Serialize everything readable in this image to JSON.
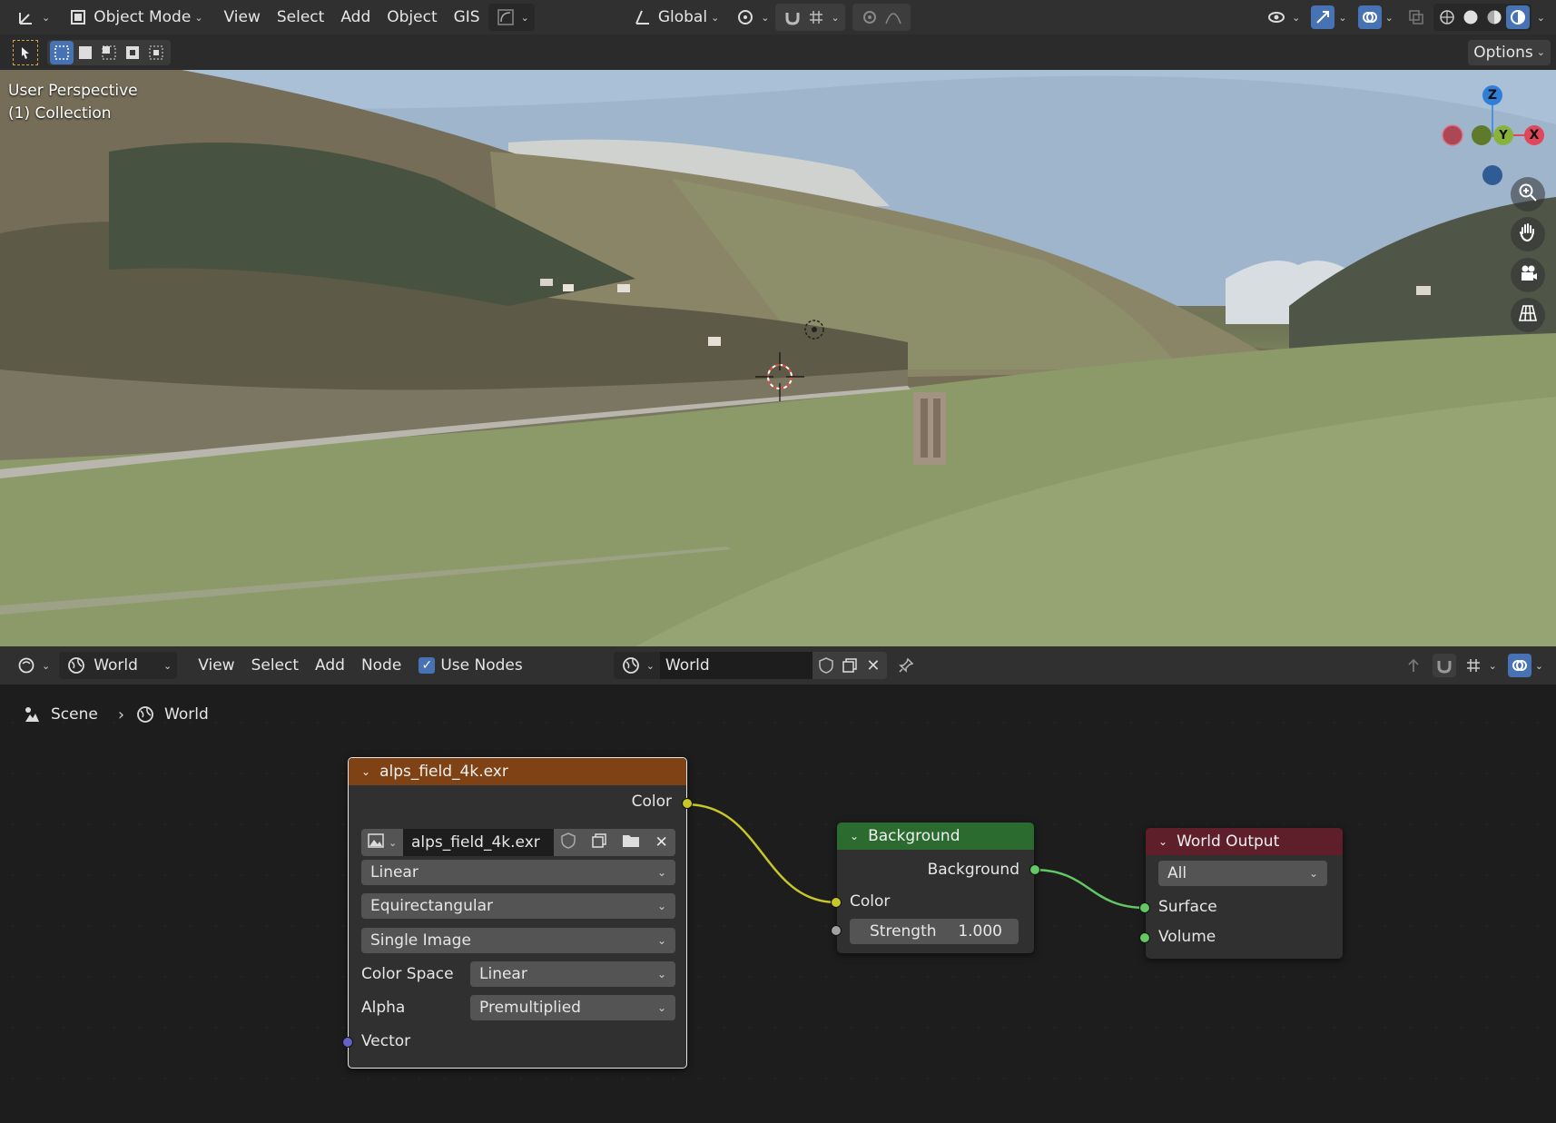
{
  "top_header": {
    "mode": "Object Mode",
    "menus": [
      "View",
      "Select",
      "Add",
      "Object",
      "GIS"
    ],
    "transform_orientation": "Global"
  },
  "tool_header": {
    "options_label": "Options"
  },
  "viewport": {
    "view_name": "User Perspective",
    "collection": "(1) Collection",
    "gizmo": {
      "z": "Z",
      "y": "Y",
      "x": "X"
    }
  },
  "node_header": {
    "editor_type": "World",
    "menus": [
      "View",
      "Select",
      "Add",
      "Node"
    ],
    "use_nodes_label": "Use Nodes",
    "use_nodes_checked": true,
    "world_name": "World"
  },
  "breadcrumb": {
    "scene": "Scene",
    "world": "World"
  },
  "nodes": {
    "image_texture": {
      "title": "alps_field_4k.exr",
      "output_color": "Color",
      "image_name": "alps_field_4k.exr",
      "interpolation": "Linear",
      "projection": "Equirectangular",
      "source": "Single Image",
      "color_space_label": "Color Space",
      "color_space_value": "Linear",
      "alpha_label": "Alpha",
      "alpha_value": "Premultiplied",
      "input_vector": "Vector"
    },
    "background": {
      "title": "Background",
      "output": "Background",
      "input_color": "Color",
      "strength_label": "Strength",
      "strength_value": "1.000"
    },
    "world_output": {
      "title": "World Output",
      "target": "All",
      "input_surface": "Surface",
      "input_volume": "Volume"
    }
  },
  "colors": {
    "image_node_header": "#7f4214",
    "background_node_header": "#2b6b2f",
    "output_node_header": "#5e1f2b",
    "socket_color": "#c7c729",
    "socket_shader": "#63c763",
    "socket_vector": "#6363c7",
    "socket_float": "#a1a1a1",
    "accent": "#4772b3"
  }
}
